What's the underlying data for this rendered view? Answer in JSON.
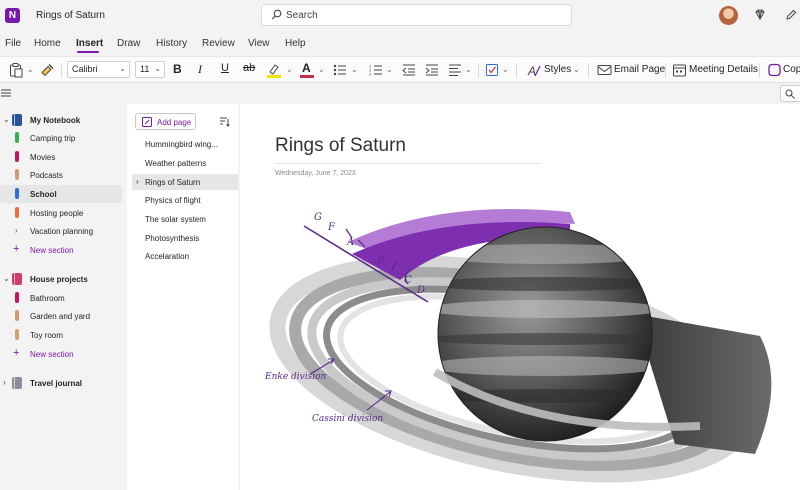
{
  "titlebar": {
    "doc_title": "Rings of Saturn",
    "search_placeholder": "Search"
  },
  "menu": [
    "File",
    "Home",
    "Insert",
    "Draw",
    "History",
    "Review",
    "View",
    "Help"
  ],
  "menu_active": "Insert",
  "ribbon": {
    "font_name": "Calibri",
    "font_size": "11",
    "bold": "B",
    "italic": "I",
    "underline": "U",
    "strike": "ab",
    "font_color_letter": "A",
    "styles_label": "Styles",
    "email_page_label": "Email Page",
    "meeting_details_label": "Meeting Details",
    "copilot_label": "Cop",
    "highlight_color": "#f2e600",
    "font_color": "#c4314b"
  },
  "notebooks": {
    "my_notebook": {
      "label": "My Notebook",
      "color": "#2b579a",
      "sections": [
        {
          "label": "Camping trip",
          "color": "#2fb34a"
        },
        {
          "label": "Movies",
          "color": "#c2185b"
        },
        {
          "label": "Podcasts",
          "color": "#d39a74"
        },
        {
          "label": "School",
          "color": "#2a6fd1"
        },
        {
          "label": "Hosting people",
          "color": "#ed6c38"
        },
        {
          "label": "Vacation planning",
          "color": ""
        }
      ],
      "new_section": "New section"
    },
    "house_projects": {
      "label": "House projects",
      "color": "#d13b6e",
      "sections": [
        {
          "label": "Bathroom",
          "color": "#c2185b"
        },
        {
          "label": "Garden and yard",
          "color": "#d39a74"
        },
        {
          "label": "Toy room",
          "color": "#d8a06a"
        }
      ],
      "new_section": "New section"
    },
    "travel_journal": {
      "label": "Travel journal",
      "color": "#8a8f99"
    }
  },
  "pages": {
    "add_page_label": "Add page",
    "items": [
      "Hummingbird wing...",
      "Weather patterns",
      "Rings of Saturn",
      "Physics of flight",
      "The solar system",
      "Photosynthesis",
      "Accelaration"
    ],
    "selected": "Rings of Saturn"
  },
  "page": {
    "title": "Rings of Saturn",
    "date": "Wednesday, June 7, 2023",
    "ring_letters": [
      "G",
      "F",
      "A",
      "B",
      "C",
      "D"
    ],
    "annotations": [
      "Enke division",
      "Cassini division"
    ],
    "ink_color": "#5b2b8a",
    "ring_highlight_color": "#8e3fbf"
  }
}
